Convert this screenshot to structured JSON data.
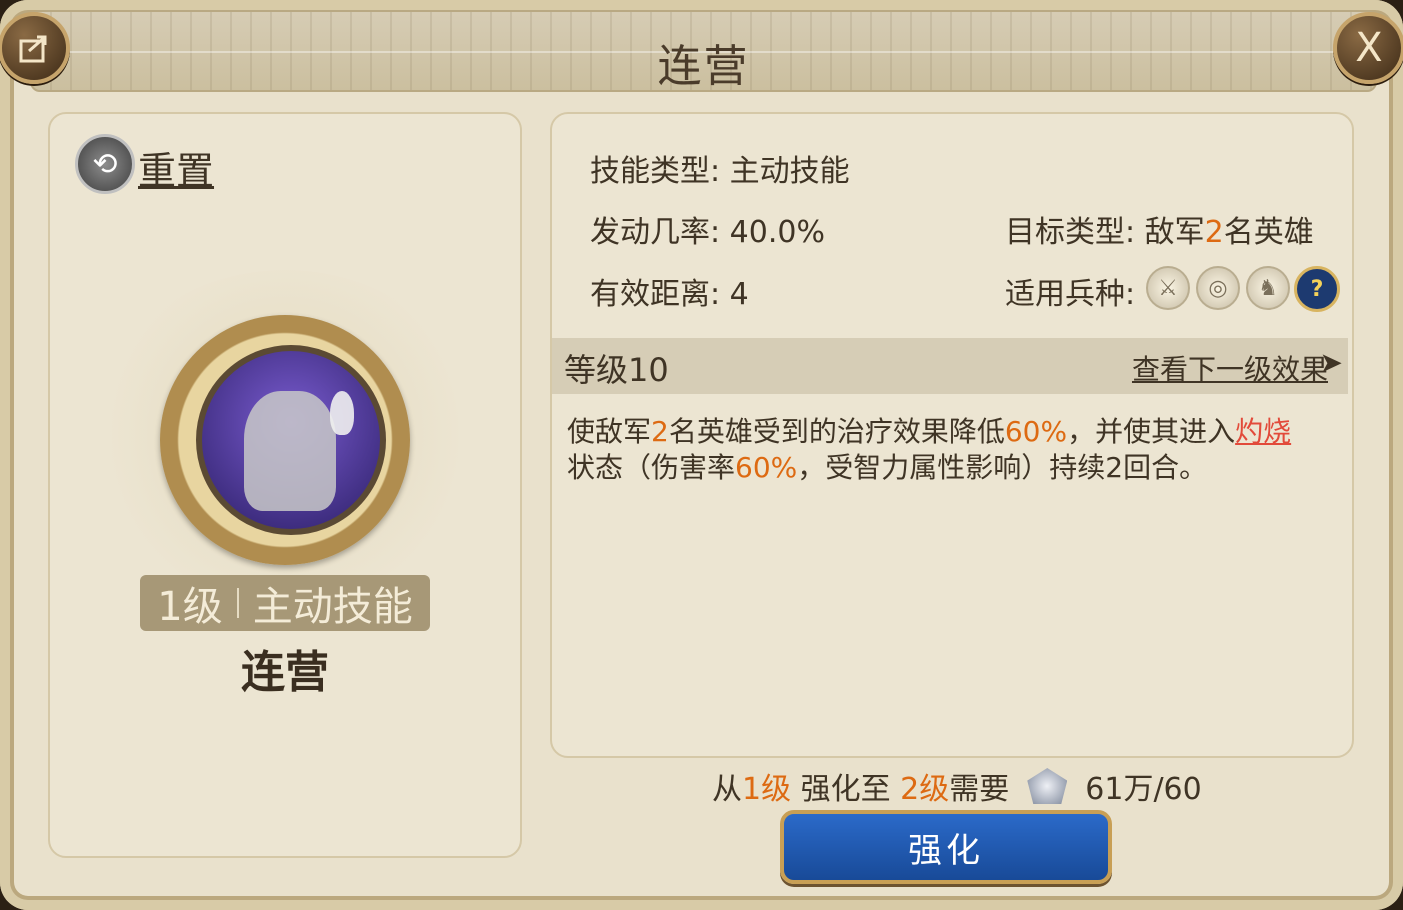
{
  "window": {
    "title": "连营"
  },
  "buttons": {
    "share_icon": "share-icon",
    "close_label": "X"
  },
  "left": {
    "reset_label": "重置",
    "badge_level": "1级",
    "badge_type": "主动技能",
    "skill_name": "连营"
  },
  "info": {
    "skill_type_label": "技能类型:",
    "skill_type_value": "主动技能",
    "trigger_rate_label": "发动几率:",
    "trigger_rate_value": "40.0%",
    "range_label": "有效距离:",
    "range_value": "4",
    "target_label": "目标类型:",
    "target_prefix": "敌军",
    "target_count": "2",
    "target_suffix": "名英雄",
    "unit_label": "适用兵种:",
    "unit_icons": [
      "sword-icon",
      "target-icon",
      "horse-icon",
      "help-icon"
    ],
    "help_text": "?"
  },
  "level": {
    "label": "等级10",
    "next_link": "查看下一级效果",
    "next_arrow": "➤"
  },
  "description": {
    "p1": "使敌军",
    "n1": "2",
    "p2": "名英雄受到的治疗效果降低",
    "n2": "60%",
    "p3": "，并使其进入",
    "link": "灼烧",
    "p4": "状态（伤害率",
    "n3": "60%",
    "p5": "，受智力属性影响）持续2回合。"
  },
  "cost": {
    "from": "从",
    "from_level": "1级",
    "mid": " 强化至 ",
    "to_level": "2级",
    "need": "需要",
    "amount": "61万/60"
  },
  "upgrade_button": "强化",
  "colors": {
    "highlight": "#dd6a12",
    "link": "#e24a3a",
    "button": "#1f5ab3"
  }
}
